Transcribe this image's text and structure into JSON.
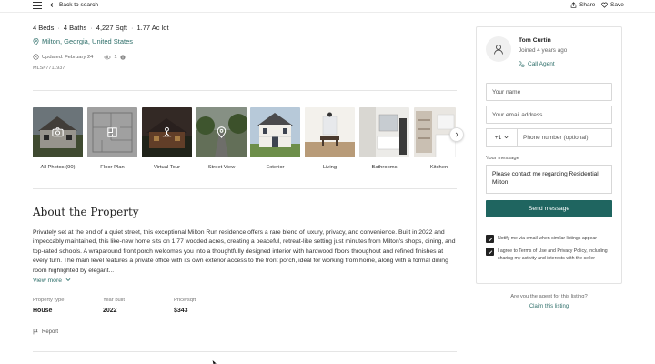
{
  "header": {
    "back_label": "Back to search",
    "share_label": "Share",
    "save_label": "Save"
  },
  "listing": {
    "beds": "4 Beds",
    "baths": "4 Baths",
    "sqft": "4,227 Sqft",
    "lot": "1.77 Ac lot",
    "location": "Milton, Georgia, United States",
    "updated": "Updated: February 24",
    "views": "1",
    "mls": "MLS#7711937"
  },
  "gallery": {
    "items": [
      {
        "label": "All Photos (90)",
        "icon": "camera-icon"
      },
      {
        "label": "Floor Plan",
        "icon": "floor-plan-icon"
      },
      {
        "label": "Virtual Tour",
        "icon": "virtual-tour-icon"
      },
      {
        "label": "Street View",
        "icon": "map-pin-icon"
      },
      {
        "label": "Exterior",
        "icon": ""
      },
      {
        "label": "Living",
        "icon": ""
      },
      {
        "label": "Bathrooms",
        "icon": ""
      },
      {
        "label": "Kitchen",
        "icon": ""
      }
    ]
  },
  "about": {
    "title": "About the Property",
    "description": "Privately set at the end of a quiet street, this exceptional Milton Run residence offers a rare blend of luxury, privacy, and convenience. Built in 2022 and impeccably maintained, this like-new home sits on 1.77 wooded acres, creating a peaceful, retreat-like setting just minutes from Milton's shops, dining, and top-rated schools. A wraparound front porch welcomes you into a thoughtfully designed interior with hardwood floors throughout and refined finishes at every turn. The main level features a private office with its own exterior access to the front porch, ideal for working from home, along with a formal dining room highlighted by elegant...",
    "view_more": "View more",
    "stats": [
      {
        "label": "Property type",
        "value": "House"
      },
      {
        "label": "Year built",
        "value": "2022"
      },
      {
        "label": "Price/sqft",
        "value": "$343"
      }
    ],
    "report_label": "Report"
  },
  "agent": {
    "name": "Tom Curtin",
    "joined": "Joined 4 years ago",
    "call_label": "Call Agent"
  },
  "contact_form": {
    "name_placeholder": "Your name",
    "email_placeholder": "Your email address",
    "country_code": "+1",
    "phone_placeholder": "Phone number (optional)",
    "message_label": "Your message",
    "message_value": "Please contact me regarding Residential Milton",
    "send_label": "Send message",
    "checkbox_notify": "Notify me via email when similar listings appear",
    "checkbox_terms": "I agree to Terms of Use and Privacy Policy, including sharing my activity and interests with the seller"
  },
  "agent_claim": {
    "question": "Are you the agent for this listing?",
    "claim_label": "Claim this listing"
  },
  "colors": {
    "accent": "#2f6f6a",
    "button": "#1f6560"
  }
}
